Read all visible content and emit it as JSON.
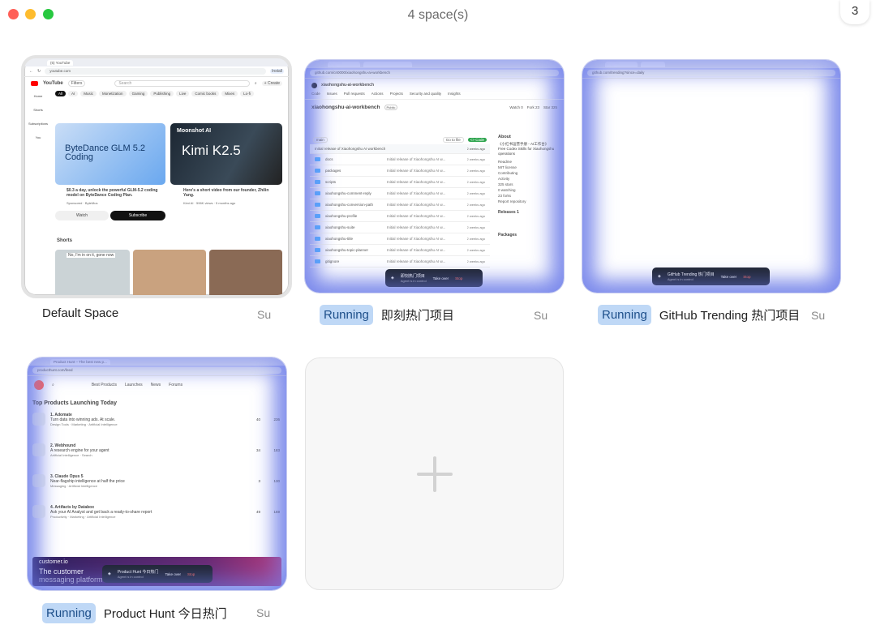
{
  "window": {
    "title": "4 space(s)",
    "badge": "3"
  },
  "spaces": [
    {
      "name": "Default Space",
      "status": "",
      "user": "Su"
    },
    {
      "name": "即刻热门项目",
      "status": "Running",
      "user": "Su"
    },
    {
      "name": "GitHub Trending 热门项目",
      "status": "Running",
      "user": "Su"
    },
    {
      "name": "Product Hunt 今日热门",
      "status": "Running",
      "user": "Su"
    }
  ],
  "yt": {
    "tab": "(6) YouTube",
    "url": "youtube.com",
    "search": "Search",
    "logo": "YouTube",
    "install": "Install",
    "create": "+ Create",
    "filters": "Filters",
    "chips": [
      "All",
      "AI",
      "Music",
      "Monetization",
      "Gaming",
      "Publishing",
      "Live",
      "Comic books",
      "Mixes",
      "Lo-fi"
    ],
    "sidebar": [
      "Home",
      "Shorts",
      "Subscriptions",
      "You"
    ],
    "ad_title": "ByteDance GLM 5.2 Coding",
    "ad_desc": "$0.3 a day, unlock the powerful GLM-5.2 coding model on ByteDance Coding Plan.",
    "ad_sponsor": "Sponsored · ByteMus",
    "watch": "Watch",
    "subscribe": "Subscribe",
    "thumb2": "Kimi K2.5",
    "thumb2_top": "Moonshot AI",
    "vid2_title": "Here's a short video from our founder, Zhilin Yang.",
    "vid2_meta": "Kimi AI · 596K views · 5 months ago",
    "shorts": "Shorts",
    "short1": "No, I'm in on it, gone now"
  },
  "gh": {
    "url": "github.com/cn0000/xiaohongshu-ai-workbench",
    "repo": "xiaohongshu-ai-workbench",
    "visibility": "Public",
    "nav": [
      "Code",
      "Issues",
      "Pull requests",
      "Actions",
      "Projects",
      "Security and quality",
      "Insights"
    ],
    "branch": "main",
    "goto": "Go to file",
    "code_btn": "<> Code",
    "watch": "Watch 0",
    "fork": "Fork 23",
    "star": "Star 325",
    "commit_msg": "Initial release of Xiaohongshu AI workbench",
    "commit_time": "2 weeks ago",
    "files": [
      "docs",
      "packages",
      "scripts",
      "xiaohongshu-comment-reply",
      "xiaohongshu-conversion-path",
      "xiaohongshu-profile",
      "xiaohongshu-suite",
      "xiaohongshu-title",
      "xiaohongshu-topic-planner",
      "gitignore"
    ],
    "file_msg": "Initial release of Xiaohongshu AI w...",
    "about_title": "About",
    "about_desc": "《小红书运营手册 - AI工作台》 Free Codex Skills for Xiaohongshu operations",
    "about_links": [
      "Readme",
      "MIT license",
      "Contributing",
      "Activity",
      "325 stars",
      "0 watching",
      "23 forks",
      "Report repository"
    ],
    "releases": "Releases 1",
    "packages": "Packages",
    "overlay_title": "即刻热门项目",
    "overlay_sub": "Agent is in control",
    "take_over": "Take over",
    "stop": "Stop"
  },
  "trend": {
    "url": "github.com/trending?since=daily",
    "overlay_title": "GitHub Trending 热门项目",
    "overlay_sub": "Agent is in control",
    "take_over": "Take over",
    "stop": "Stop"
  },
  "ph": {
    "tab": "Product Hunt – The best new p...",
    "url": "producthunt.com/feed",
    "nav": [
      "Best Products",
      "Launches",
      "News",
      "Forums"
    ],
    "heading": "Top Products Launching Today",
    "products": [
      {
        "name": "1. Adomate",
        "desc": "Turn data into winning ads. At scale.",
        "tags": "Design Tools · Marketing · Artificial Intelligence",
        "comments": "40",
        "votes": "236"
      },
      {
        "name": "2. Webhound",
        "desc": "A research engine for your agent",
        "tags": "Artificial Intelligence · Search",
        "comments": "34",
        "votes": "183"
      },
      {
        "name": "3. Claude Opus 5",
        "desc": "Near-flagship intelligence at half the price",
        "tags": "Messaging · Artificial Intelligence",
        "comments": "3",
        "votes": "130"
      },
      {
        "name": "4. Artifacts by Databox",
        "desc": "Ask your AI Analyst and get back a ready-to-share report",
        "tags": "Productivity · Marketing · Artificial Intelligence",
        "comments": "49",
        "votes": "169"
      }
    ],
    "banner_brand": "customer.io",
    "banner_text1": "The customer",
    "banner_text2": "messaging platform",
    "overlay_title": "Product Hunt 今日热门",
    "overlay_sub": "Agent is in control",
    "take_over": "Take over",
    "stop": "Stop"
  },
  "colors": {
    "running_bg": "#bfd8f6",
    "glow": "#7887e6",
    "stop": "#ff6b57"
  }
}
